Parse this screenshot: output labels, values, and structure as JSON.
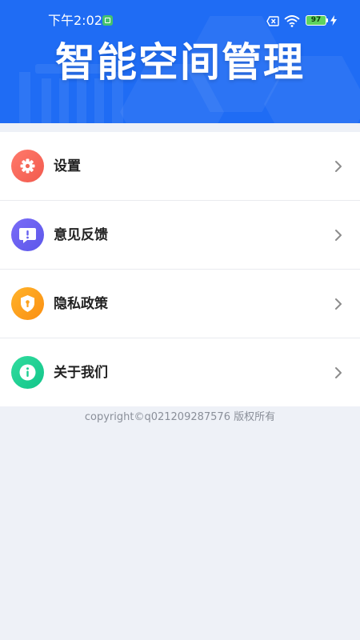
{
  "status_bar": {
    "time": "下午2:02",
    "battery_level": "97",
    "icons": [
      "notification-icon",
      "sim-off-icon",
      "wifi-icon",
      "battery-icon",
      "charging-icon"
    ]
  },
  "header": {
    "title": "智能空间管理",
    "background_color": "#1f6cf4"
  },
  "menu": {
    "items": [
      {
        "label": "设置",
        "icon": "gear-icon",
        "color_from": "#ff7a6b",
        "color_to": "#f25a4e"
      },
      {
        "label": "意见反馈",
        "icon": "feedback-icon",
        "color_from": "#7a6cf7",
        "color_to": "#5c57ea"
      },
      {
        "label": "隐私政策",
        "icon": "shield-icon",
        "color_from": "#ffb32a",
        "color_to": "#fb8f12"
      },
      {
        "label": "关于我们",
        "icon": "info-icon",
        "color_from": "#31dc9e",
        "color_to": "#12c58a"
      }
    ]
  },
  "footer": {
    "copyright": "copyright©q021209287576 版权所有"
  }
}
